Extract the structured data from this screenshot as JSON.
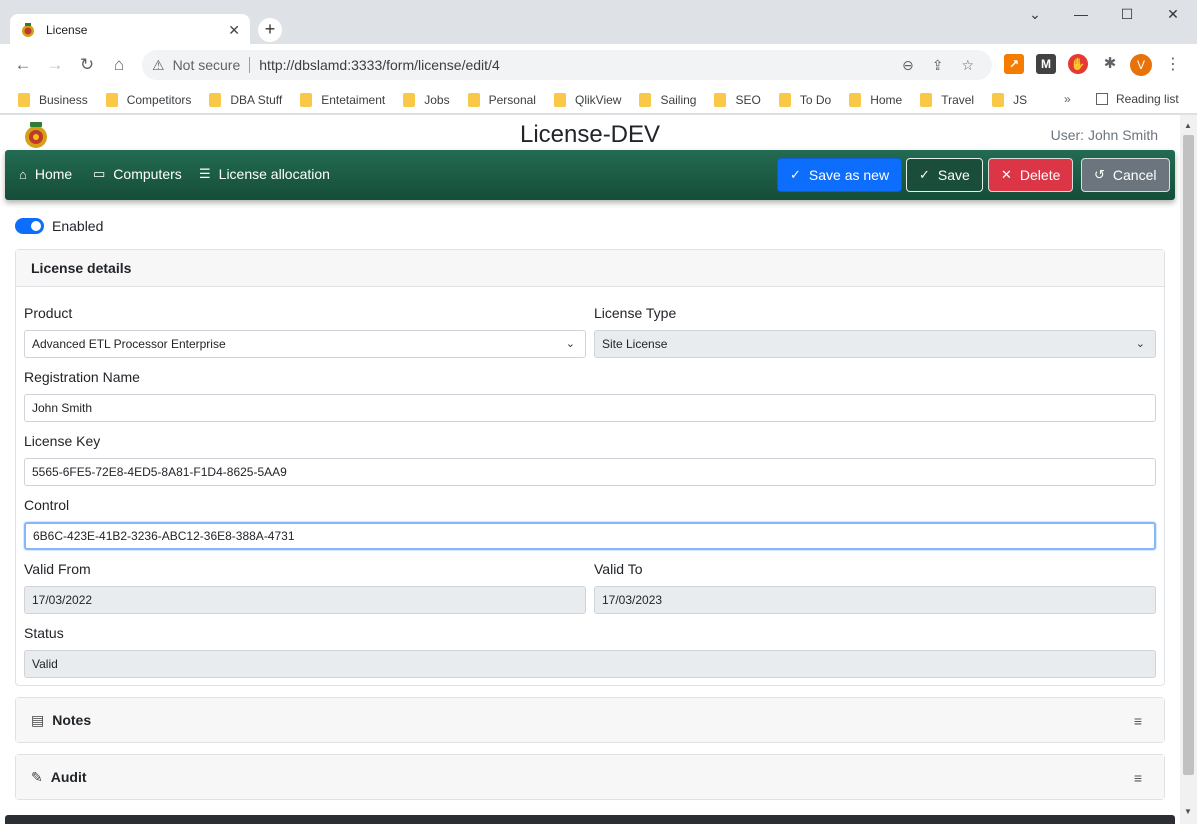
{
  "browser": {
    "tab_title": "License",
    "security": "Not secure",
    "url": "http://dbslamd:3333/form/license/edit/4",
    "profile_initial": "V",
    "bookmarks": [
      "Business",
      "Competitors",
      "DBA Stuff",
      "Entetaiment",
      "Jobs",
      "Personal",
      "QlikView",
      "Sailing",
      "SEO",
      "To Do",
      "Home",
      "Travel",
      "JS"
    ],
    "more": "»",
    "reading_list": "Reading list"
  },
  "page": {
    "title": "License-DEV",
    "user": "User: John Smith"
  },
  "nav": {
    "home": "Home",
    "computers": "Computers",
    "license_allocation": "License allocation"
  },
  "actions": {
    "save_as_new": "Save as new",
    "save": "Save",
    "delete": "Delete",
    "cancel": "Cancel"
  },
  "enabled": {
    "label": "Enabled",
    "value": true
  },
  "license_details": {
    "header": "License details",
    "product": {
      "label": "Product",
      "value": "Advanced ETL Processor Enterprise"
    },
    "license_type": {
      "label": "License Type",
      "value": "Site License"
    },
    "registration_name": {
      "label": "Registration Name",
      "value": "John Smith"
    },
    "license_key": {
      "label": "License Key",
      "value": "5565-6FE5-72E8-4ED5-8A81-F1D4-8625-5AA9"
    },
    "control": {
      "label": "Control",
      "value": "6B6C-423E-41B2-3236-ABC12-36E8-388A-4731"
    },
    "valid_from": {
      "label": "Valid From",
      "value": "17/03/2022"
    },
    "valid_to": {
      "label": "Valid To",
      "value": "17/03/2023"
    },
    "status": {
      "label": "Status",
      "value": "Valid"
    }
  },
  "sections": {
    "notes": "Notes",
    "audit": "Audit"
  },
  "colors": {
    "navbar": "#1b5e45",
    "primary": "#0d6efd",
    "danger": "#dc3545",
    "secondary": "#6c757d"
  }
}
